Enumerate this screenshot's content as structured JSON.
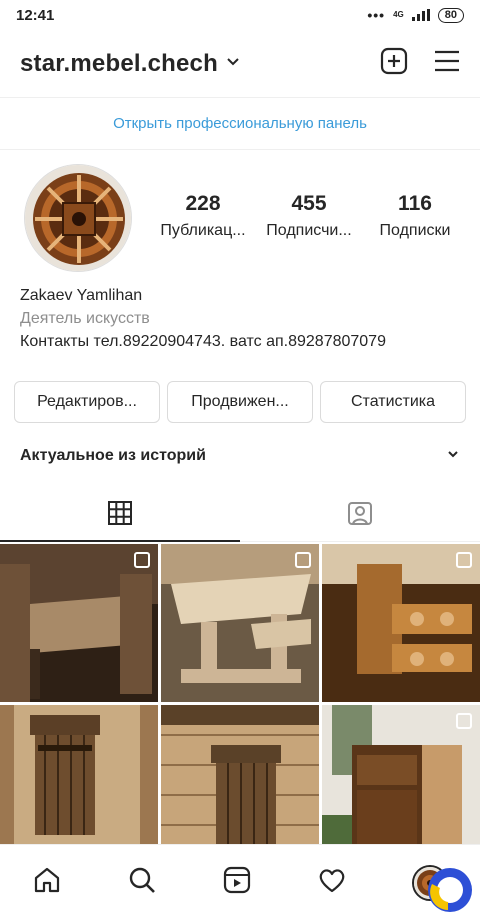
{
  "status": {
    "time": "12:41",
    "network": "4G",
    "battery": "80"
  },
  "header": {
    "username": "star.mebel.chech"
  },
  "pro_panel": {
    "label": "Открыть профессиональную панель"
  },
  "profile": {
    "stats": [
      {
        "value": "228",
        "label": "Публикац..."
      },
      {
        "value": "455",
        "label": "Подписчи..."
      },
      {
        "value": "116",
        "label": "Подписки"
      }
    ],
    "name": "Zakaev Yamlihan",
    "category": "Деятель искусств",
    "contacts": "Контакты тел.89220904743. ватс ап.89287807079"
  },
  "buttons": {
    "edit": "Редактиров...",
    "promote": "Продвижен...",
    "stats": "Статистика"
  },
  "highlights": {
    "title": "Актуальное из историй"
  },
  "tabs": [
    {
      "icon": "grid-icon",
      "active": true
    },
    {
      "icon": "tagged-icon",
      "active": false
    }
  ],
  "grid": [
    {
      "subject": "wooden dining set with carved chairs",
      "multi": true,
      "palette": [
        "#3b2a1c",
        "#6e5138",
        "#a88a68"
      ]
    },
    {
      "subject": "light wooden table with benches",
      "multi": true,
      "palette": [
        "#8b7355",
        "#cdb596",
        "#e4d3b6"
      ]
    },
    {
      "subject": "burnt wood cup holder",
      "multi": true,
      "palette": [
        "#4a2c12",
        "#a56a2e",
        "#e0b27a"
      ]
    },
    {
      "subject": "wooden key holder on wall",
      "multi": false,
      "palette": [
        "#5b3f26",
        "#9c7750",
        "#d4b48a"
      ]
    },
    {
      "subject": "wooden key holder on plank wall",
      "multi": false,
      "palette": [
        "#5a4128",
        "#8f6d48",
        "#c7a57a"
      ]
    },
    {
      "subject": "burnt wood cabinet",
      "multi": true,
      "palette": [
        "#3f2512",
        "#7a4d26",
        "#c79b6a"
      ]
    }
  ],
  "bottom_nav": [
    "home-icon",
    "search-icon",
    "reels-icon",
    "heart-icon",
    "profile-avatar"
  ]
}
